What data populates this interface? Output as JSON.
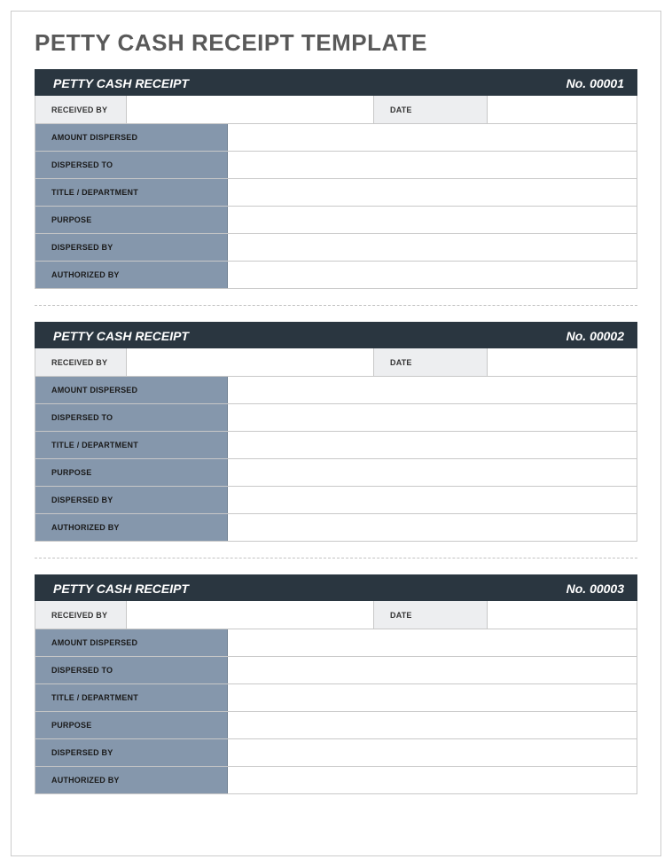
{
  "title": "PETTY CASH RECEIPT TEMPLATE",
  "receipts": [
    {
      "header_title": "PETTY CASH RECEIPT",
      "header_no": "No. 00001",
      "received_by_label": "RECEIVED BY",
      "received_by_value": "",
      "date_label": "DATE",
      "date_value": "",
      "fields": [
        {
          "label": "AMOUNT DISPERSED",
          "value": ""
        },
        {
          "label": "DISPERSED TO",
          "value": ""
        },
        {
          "label": "TITLE / DEPARTMENT",
          "value": ""
        },
        {
          "label": "PURPOSE",
          "value": ""
        },
        {
          "label": "DISPERSED BY",
          "value": ""
        },
        {
          "label": "AUTHORIZED BY",
          "value": ""
        }
      ]
    },
    {
      "header_title": "PETTY CASH RECEIPT",
      "header_no": "No. 00002",
      "received_by_label": "RECEIVED BY",
      "received_by_value": "",
      "date_label": "DATE",
      "date_value": "",
      "fields": [
        {
          "label": "AMOUNT DISPERSED",
          "value": ""
        },
        {
          "label": "DISPERSED TO",
          "value": ""
        },
        {
          "label": "TITLE / DEPARTMENT",
          "value": ""
        },
        {
          "label": "PURPOSE",
          "value": ""
        },
        {
          "label": "DISPERSED BY",
          "value": ""
        },
        {
          "label": "AUTHORIZED BY",
          "value": ""
        }
      ]
    },
    {
      "header_title": "PETTY CASH RECEIPT",
      "header_no": "No. 00003",
      "received_by_label": "RECEIVED BY",
      "received_by_value": "",
      "date_label": "DATE",
      "date_value": "",
      "fields": [
        {
          "label": "AMOUNT DISPERSED",
          "value": ""
        },
        {
          "label": "DISPERSED TO",
          "value": ""
        },
        {
          "label": "TITLE / DEPARTMENT",
          "value": ""
        },
        {
          "label": "PURPOSE",
          "value": ""
        },
        {
          "label": "DISPERSED BY",
          "value": ""
        },
        {
          "label": "AUTHORIZED BY",
          "value": ""
        }
      ]
    }
  ]
}
